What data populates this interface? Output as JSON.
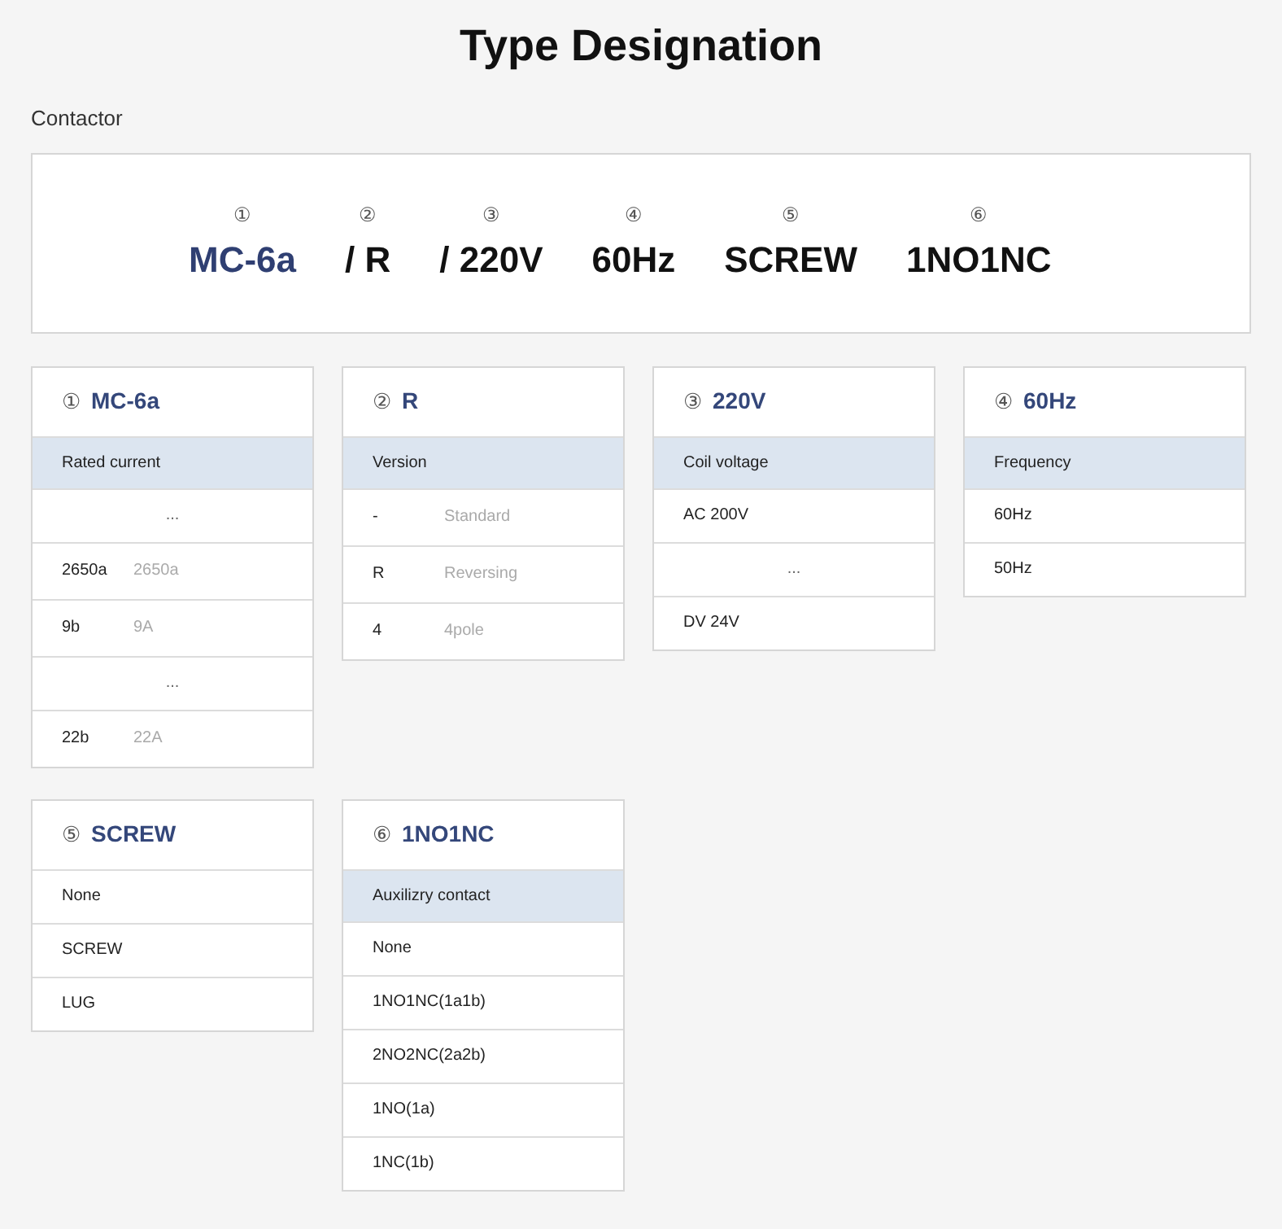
{
  "title": "Type Designation",
  "subtitle": "Contactor",
  "designation": [
    {
      "number": "①",
      "value": "MC-6a",
      "color": "#2f3f72"
    },
    {
      "number": "②",
      "value": "/ R",
      "color": "#111111"
    },
    {
      "number": "③",
      "value": "/ 220V",
      "color": "#111111"
    },
    {
      "number": "④",
      "value": "60Hz",
      "color": "#111111"
    },
    {
      "number": "⑤",
      "value": "SCREW",
      "color": "#111111"
    },
    {
      "number": "⑥",
      "value": "1NO1NC",
      "color": "#111111"
    }
  ],
  "cards": [
    {
      "number": "①",
      "title": "MC-6a",
      "header": "Rated current",
      "rows": [
        {
          "kind": "ellipsis",
          "code": "..."
        },
        {
          "kind": "pair",
          "code": "2650a",
          "desc": "2650a"
        },
        {
          "kind": "pair",
          "code": "9b",
          "desc": "9A"
        },
        {
          "kind": "ellipsis",
          "code": "..."
        },
        {
          "kind": "pair",
          "code": "22b",
          "desc": "22A"
        }
      ]
    },
    {
      "number": "②",
      "title": "R",
      "header": "Version",
      "rows": [
        {
          "kind": "pair",
          "code": "-",
          "desc": "Standard"
        },
        {
          "kind": "pair",
          "code": "R",
          "desc": "Reversing"
        },
        {
          "kind": "pair",
          "code": "4",
          "desc": "4pole"
        }
      ]
    },
    {
      "number": "③",
      "title": "220V",
      "header": "Coil voltage",
      "rows": [
        {
          "kind": "single",
          "code": "AC 200V"
        },
        {
          "kind": "ellipsis",
          "code": "..."
        },
        {
          "kind": "single",
          "code": "DV 24V"
        }
      ]
    },
    {
      "number": "④",
      "title": "60Hz",
      "header": "Frequency",
      "rows": [
        {
          "kind": "single",
          "code": "60Hz"
        },
        {
          "kind": "single",
          "code": "50Hz"
        }
      ]
    },
    {
      "number": "⑤",
      "title": "SCREW",
      "rows": [
        {
          "kind": "single",
          "code": "None"
        },
        {
          "kind": "single",
          "code": "SCREW"
        },
        {
          "kind": "single",
          "code": "LUG"
        }
      ]
    },
    {
      "number": "⑥",
      "title": "1NO1NC",
      "header": "Auxilizry contact",
      "rows": [
        {
          "kind": "single",
          "code": "None"
        },
        {
          "kind": "single",
          "code": "1NO1NC(1a1b)"
        },
        {
          "kind": "single",
          "code": "2NO2NC(2a2b)"
        },
        {
          "kind": "single",
          "code": "1NO(1a)"
        },
        {
          "kind": "single",
          "code": "1NC(1b)"
        }
      ]
    }
  ]
}
